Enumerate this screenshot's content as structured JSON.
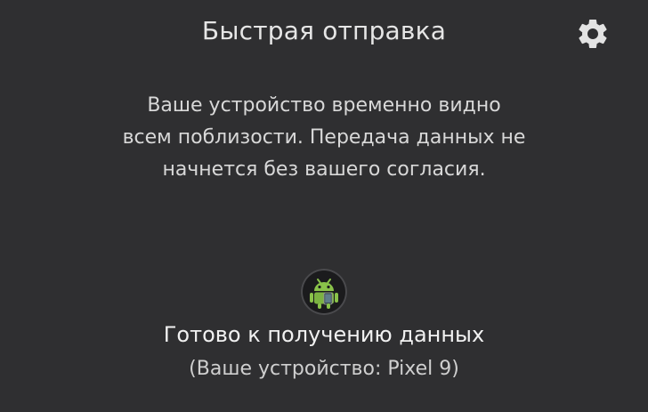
{
  "header": {
    "title": "Быстрая отправка",
    "settings_icon": "gear-icon"
  },
  "description": {
    "lines": [
      "Ваше устройство временно видно",
      "всем поблизости. Передача данных не",
      "начнется без вашего согласия."
    ]
  },
  "receiver": {
    "avatar_icon": "android-robot-icon",
    "status": "Готово к получению данных",
    "device_label": "(Ваше устройство: Pixel 9)"
  },
  "colors": {
    "background": "#2f2f31",
    "primary_text": "#f1f1f1",
    "secondary_text": "#d8d8d8",
    "android_green": "#8ac34a"
  }
}
